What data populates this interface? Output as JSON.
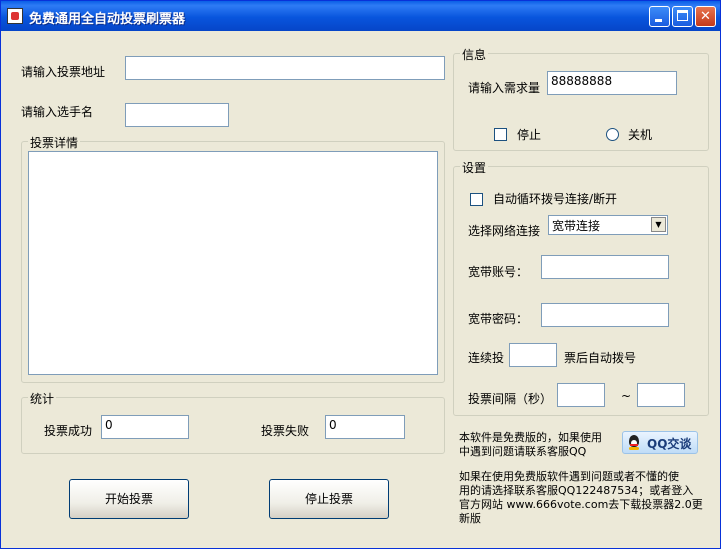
{
  "window": {
    "title": "免费通用全自动投票刷票器"
  },
  "form": {
    "url_label": "请输入投票地址",
    "url_value": "",
    "name_label": "请输入选手名",
    "name_value": ""
  },
  "details": {
    "title": "投票详情"
  },
  "stats": {
    "title": "统计",
    "success_label": "投票成功",
    "success_value": "0",
    "fail_label": "投票失败",
    "fail_value": "0"
  },
  "actions": {
    "start": "开始投票",
    "stop": "停止投票"
  },
  "info": {
    "title": "信息",
    "demand_label": "请输入需求量",
    "demand_value": "88888888",
    "stop_label": "停止",
    "shutdown_label": "关机"
  },
  "settings": {
    "title": "设置",
    "auto_dial_label": "自动循环拨号连接/断开",
    "network_label": "选择网络连接",
    "network_value": "宽带连接",
    "account_label": "宽带账号：",
    "password_label": "宽带密码：",
    "continuous_label": "连续投",
    "after_label": "票后自动拨号",
    "interval_label": "投票间隔（秒）",
    "tilde": "~"
  },
  "notes": {
    "free_line1": "本软件是免费版的，如果使用",
    "free_line2": "中遇到问题请联系客服QQ",
    "qq_button": "QQ交谈",
    "bottom_line1": "如果在使用免费版软件遇到问题或者不懂的使",
    "bottom_line2": "用的请选择联系客服QQ122487534；或者登入",
    "bottom_line3": "官方网站 www.666vote.com去下载投票器2.0更",
    "bottom_line4": "新版"
  }
}
